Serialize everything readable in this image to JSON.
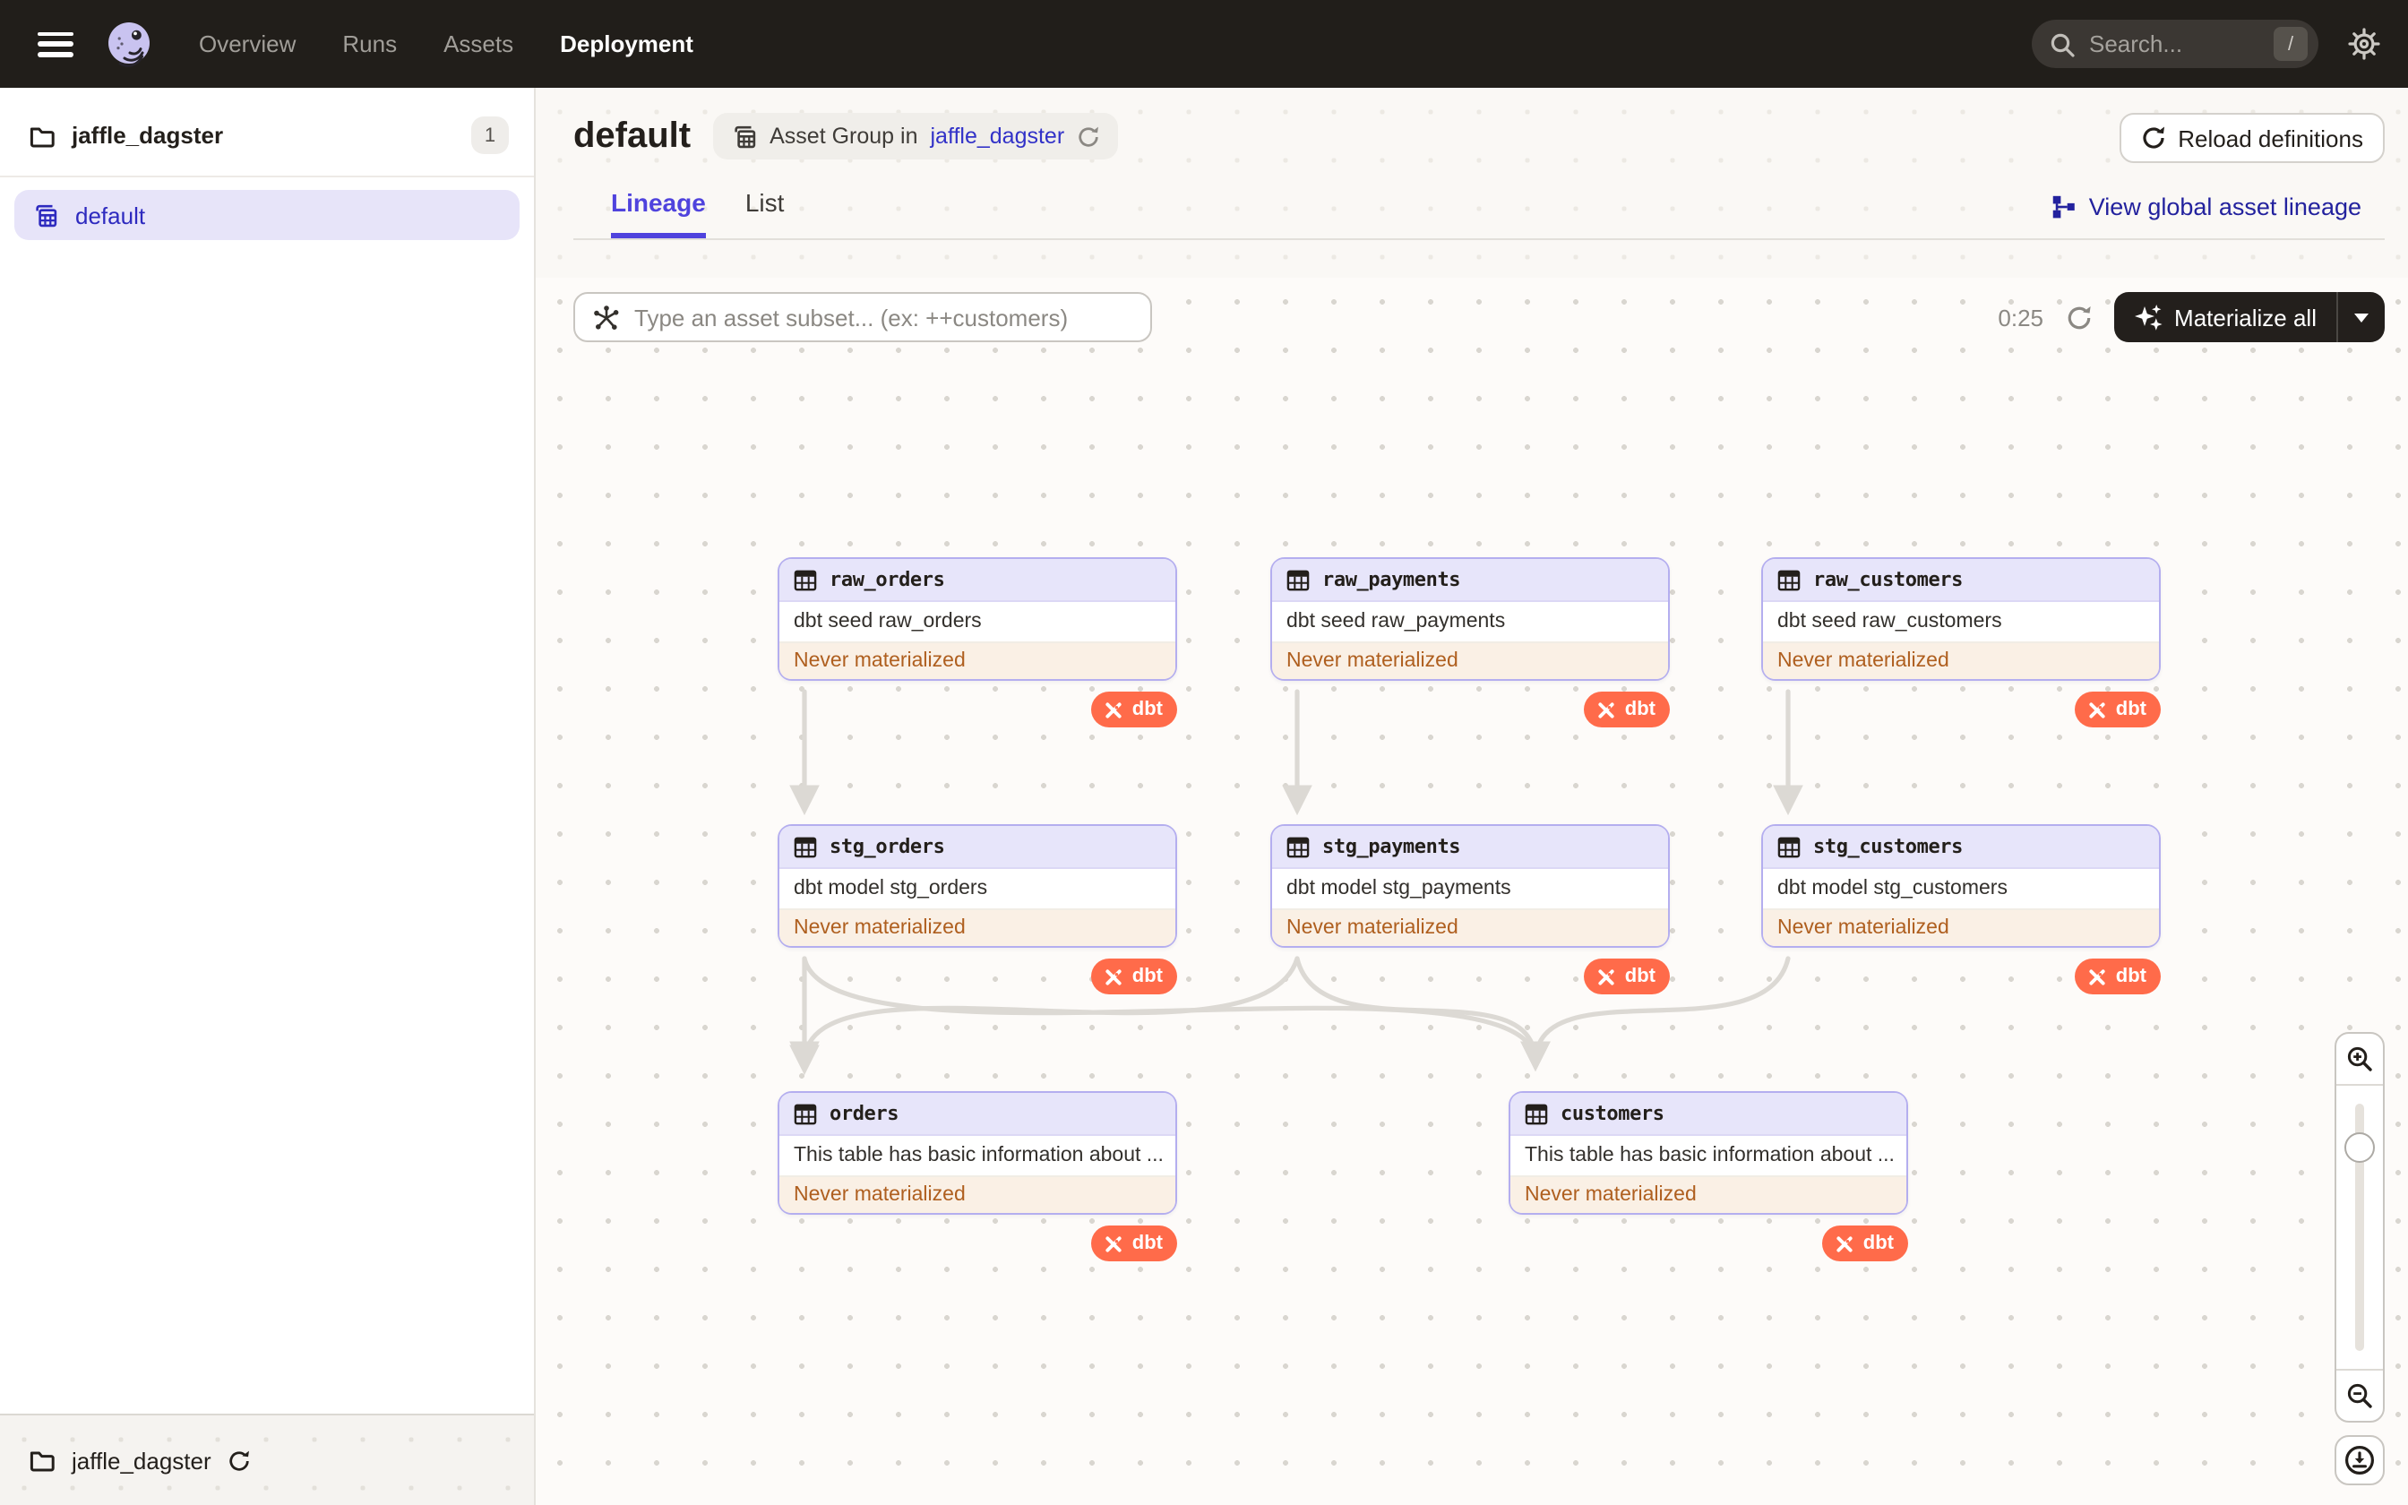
{
  "topnav": {
    "links": [
      {
        "label": "Overview"
      },
      {
        "label": "Runs"
      },
      {
        "label": "Assets"
      },
      {
        "label": "Deployment"
      }
    ],
    "search_placeholder": "Search...",
    "search_shortcut": "/"
  },
  "sidebar": {
    "repo_name": "jaffle_dagster",
    "repo_count": "1",
    "group_label": "default",
    "footer_repo": "jaffle_dagster"
  },
  "page": {
    "title": "default",
    "badge_text": "Asset Group in",
    "badge_link": "jaffle_dagster",
    "reload_button": "Reload definitions",
    "tabs": [
      {
        "label": "Lineage"
      },
      {
        "label": "List"
      }
    ],
    "global_lineage": "View global asset lineage"
  },
  "toolbar": {
    "filter_placeholder": "Type an asset subset... (ex: ++customers)",
    "timer": "0:25",
    "materialize": "Materialize all"
  },
  "graph": {
    "nodes": [
      {
        "title": "raw_orders",
        "description": "dbt seed raw_orders",
        "status": "Never materialized",
        "badge": "dbt"
      },
      {
        "title": "raw_payments",
        "description": "dbt seed raw_payments",
        "status": "Never materialized",
        "badge": "dbt"
      },
      {
        "title": "raw_customers",
        "description": "dbt seed raw_customers",
        "status": "Never materialized",
        "badge": "dbt"
      },
      {
        "title": "stg_orders",
        "description": "dbt model stg_orders",
        "status": "Never materialized",
        "badge": "dbt"
      },
      {
        "title": "stg_payments",
        "description": "dbt model stg_payments",
        "status": "Never materialized",
        "badge": "dbt"
      },
      {
        "title": "stg_customers",
        "description": "dbt model stg_customers",
        "status": "Never materialized",
        "badge": "dbt"
      },
      {
        "title": "orders",
        "description": "This table has basic information about ...",
        "status": "Never materialized",
        "badge": "dbt"
      },
      {
        "title": "customers",
        "description": "This table has basic information about ...",
        "status": "Never materialized",
        "badge": "dbt"
      }
    ]
  },
  "colors": {
    "accent": "#4F43DD",
    "dbt_orange": "#FF6B4A",
    "status_orange": "#AF5F1F",
    "nav_bg": "#211E1A",
    "node_border": "#B4AEEF"
  }
}
